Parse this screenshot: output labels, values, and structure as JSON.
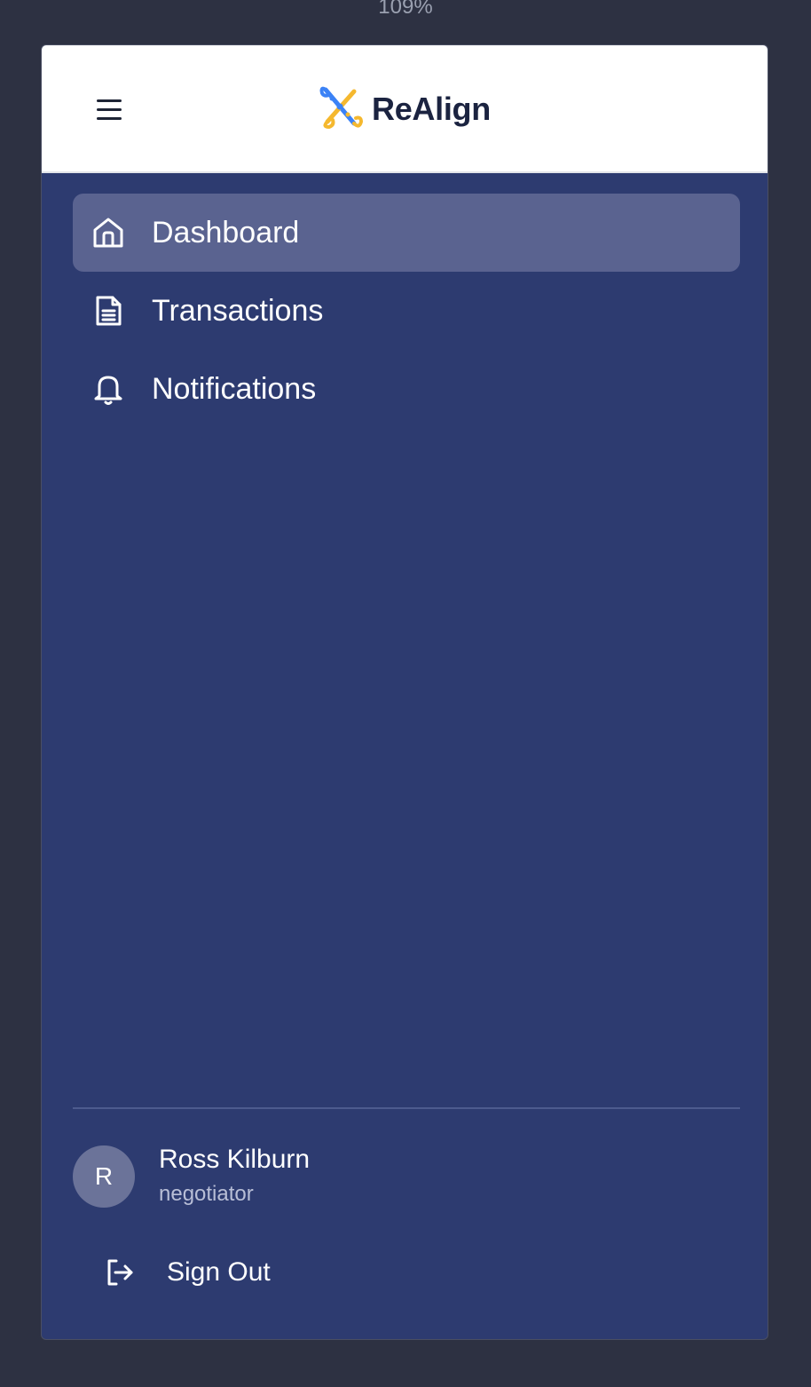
{
  "window": {
    "zoom_level": "109%"
  },
  "header": {
    "brand_name": "ReAlign",
    "menu_icon": "hamburger-menu-icon",
    "logo_icon": "realign-logo-icon"
  },
  "sidebar": {
    "items": [
      {
        "label": "Dashboard",
        "icon": "home-icon",
        "active": true
      },
      {
        "label": "Transactions",
        "icon": "document-icon",
        "active": false
      },
      {
        "label": "Notifications",
        "icon": "bell-icon",
        "active": false
      }
    ]
  },
  "user": {
    "avatar_initial": "R",
    "name": "Ross Kilburn",
    "role": "negotiator"
  },
  "footer": {
    "sign_out_label": "Sign Out",
    "sign_out_icon": "sign-out-icon"
  },
  "colors": {
    "sidebar_bg": "#2d3b70",
    "active_item_bg": "#5a6390",
    "logo_blue": "#3b82f6",
    "logo_yellow": "#f5b82e"
  }
}
